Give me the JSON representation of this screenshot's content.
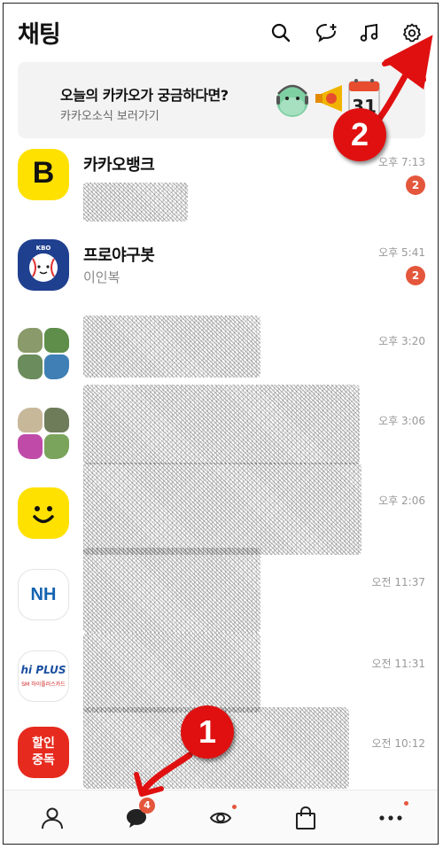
{
  "header": {
    "title": "채팅",
    "icons": [
      "search-icon",
      "new-chat-icon",
      "music-icon",
      "settings-icon"
    ]
  },
  "banner": {
    "title": "오늘의 카카오가 궁금하다면?",
    "subtitle": "카카오소식 보러가기",
    "calendar_day": "31"
  },
  "chats": [
    {
      "name": "카카오뱅크",
      "preview": "",
      "time": "오후 7:13",
      "unread": "2",
      "avatar_text": "B"
    },
    {
      "name": "프로야구봇",
      "preview": "이인복",
      "time": "오후 5:41",
      "unread": "2",
      "avatar_text": "KBO"
    },
    {
      "name": "",
      "preview": "",
      "time": "오후 3:20"
    },
    {
      "name": "",
      "preview": "",
      "time": "오후 3:06"
    },
    {
      "name": "",
      "preview": "",
      "time": "오후 2:06"
    },
    {
      "name": "",
      "preview": "",
      "time": "오전 11:37",
      "avatar_text": "NH"
    },
    {
      "name": "",
      "preview": "",
      "time": "오전 11:31",
      "avatar_text": "hi PLUS",
      "avatar_subtext": "SM 하이플러스카드"
    },
    {
      "name": "",
      "preview": "",
      "time": "오전 10:12",
      "avatar_text": "할인\n중독"
    }
  ],
  "bottom_nav": {
    "items": [
      "friends-icon",
      "chats-icon",
      "view-icon",
      "shopping-icon",
      "more-icon"
    ],
    "chats_badge": "4"
  },
  "annotations": {
    "step1": "1",
    "step2": "2"
  },
  "colors": {
    "badge": "#e4573c",
    "annotation": "#e01010",
    "kakao_yellow": "#ffe100"
  }
}
